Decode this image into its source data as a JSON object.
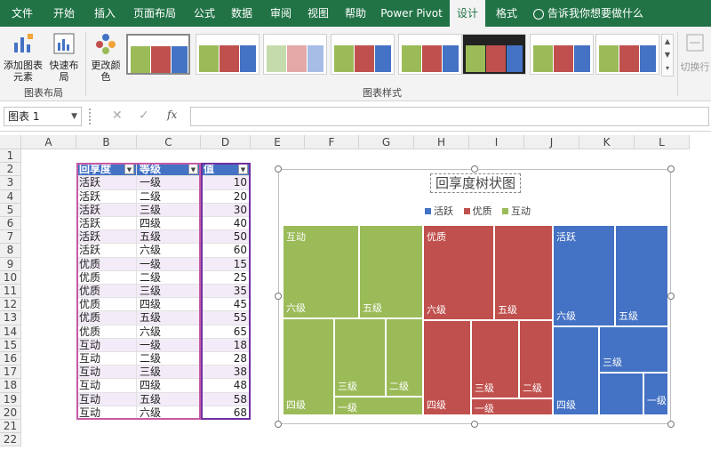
{
  "tabs": [
    "文件",
    "开始",
    "插入",
    "页面布局",
    "公式",
    "数据",
    "审阅",
    "视图",
    "帮助",
    "Power Pivot",
    "设计",
    "格式"
  ],
  "active_tab": "设计",
  "tell_me": "告诉我你想要做什么",
  "ribbon": {
    "add_element": "添加图表元素",
    "quick_layout": "快速布局",
    "change_color": "更改颜色",
    "layout_group": "图表布局",
    "styles_group": "图表样式",
    "switch_rowcol": "切换行"
  },
  "name_box": "图表 1",
  "fx": "fx",
  "columns": [
    "A",
    "B",
    "C",
    "D",
    "E",
    "F",
    "G",
    "H",
    "I",
    "J",
    "K",
    "L"
  ],
  "rows": [
    "1",
    "2",
    "3",
    "4",
    "5",
    "6",
    "7",
    "8",
    "9",
    "10",
    "11",
    "12",
    "13",
    "14",
    "15",
    "16",
    "17",
    "18",
    "19",
    "20",
    "21",
    "22"
  ],
  "table": {
    "headers": [
      "回享度",
      "等级",
      "值"
    ],
    "data": [
      [
        "活跃",
        "一级",
        "10"
      ],
      [
        "活跃",
        "二级",
        "20"
      ],
      [
        "活跃",
        "三级",
        "30"
      ],
      [
        "活跃",
        "四级",
        "40"
      ],
      [
        "活跃",
        "五级",
        "50"
      ],
      [
        "活跃",
        "六级",
        "60"
      ],
      [
        "优质",
        "一级",
        "15"
      ],
      [
        "优质",
        "二级",
        "25"
      ],
      [
        "优质",
        "三级",
        "35"
      ],
      [
        "优质",
        "四级",
        "45"
      ],
      [
        "优质",
        "五级",
        "55"
      ],
      [
        "优质",
        "六级",
        "65"
      ],
      [
        "互动",
        "一级",
        "18"
      ],
      [
        "互动",
        "二级",
        "28"
      ],
      [
        "互动",
        "三级",
        "38"
      ],
      [
        "互动",
        "四级",
        "48"
      ],
      [
        "互动",
        "五级",
        "58"
      ],
      [
        "互动",
        "六级",
        "68"
      ]
    ]
  },
  "chart": {
    "title": "回享度树状图",
    "legend": [
      {
        "name": "活跃",
        "color": "#4472c4"
      },
      {
        "name": "优质",
        "color": "#c0504d"
      },
      {
        "name": "互动",
        "color": "#9bbb59"
      }
    ],
    "group_labels": {
      "hudong": "互动",
      "youzhi": "优质",
      "huoyue": "活跃"
    },
    "tile_labels": {
      "l6": "六级",
      "l5": "五级",
      "l4": "四级",
      "l3": "三级",
      "l2": "二级",
      "l1": "一级"
    }
  },
  "colors": {
    "green": "#9bbb59",
    "red": "#c0504d",
    "blue": "#4472c4",
    "excel": "#217346"
  }
}
